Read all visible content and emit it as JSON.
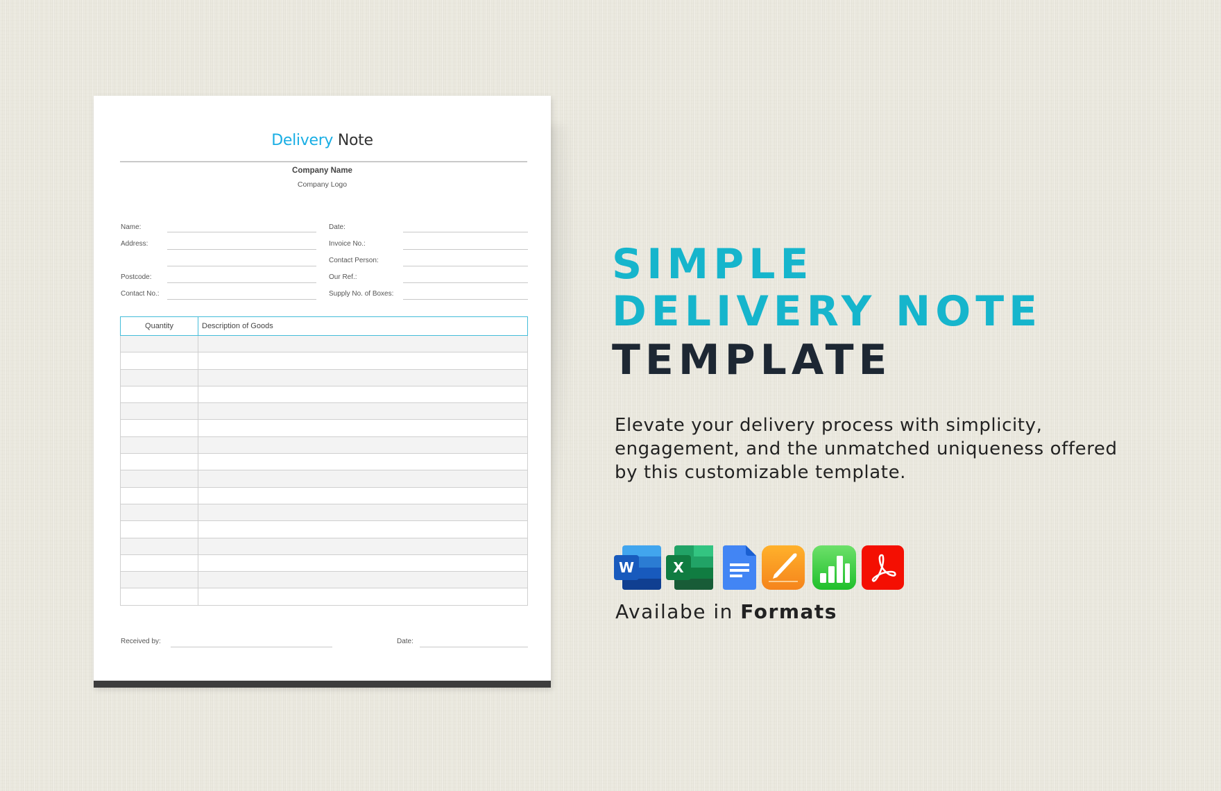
{
  "document": {
    "title_accent": "Delivery",
    "title_rest": "Note",
    "company_name": "Company Name",
    "company_logo": "Company Logo",
    "fields_left": [
      {
        "label": "Name:",
        "value": ""
      },
      {
        "label": "Address:",
        "value": ""
      },
      {
        "label": "",
        "value": ""
      },
      {
        "label": "Postcode:",
        "value": ""
      },
      {
        "label": "Contact No.:",
        "value": ""
      }
    ],
    "fields_right": [
      {
        "label": "Date:",
        "value": ""
      },
      {
        "label": "Invoice No.:",
        "value": ""
      },
      {
        "label": "Contact Person:",
        "value": ""
      },
      {
        "label": "Our Ref.:",
        "value": ""
      },
      {
        "label": "Supply No. of Boxes:",
        "value": ""
      }
    ],
    "table": {
      "columns": [
        "Quantity",
        "Description of Goods"
      ],
      "row_count": 16,
      "rows": []
    },
    "signature": {
      "received_by_label": "Received by:",
      "date_label": "Date:"
    }
  },
  "hero": {
    "line1": "SIMPLE",
    "line2": "DELIVERY NOTE",
    "line3": "TEMPLATE",
    "description_lines": [
      "Elevate your delivery process with simplicity,",
      "engagement, and the unmatched uniqueness offered",
      "by this customizable template."
    ]
  },
  "formats": {
    "icons": [
      "word-icon",
      "excel-icon",
      "google-docs-icon",
      "pages-icon",
      "numbers-icon",
      "pdf-icon"
    ],
    "caption_prefix": "Availabe in",
    "caption_bold": "Formats"
  },
  "colors": {
    "accent_cyan": "#16b5cc",
    "title_blue": "#19aee4",
    "dark_text": "#1d2733",
    "table_header_border": "#43bcd9",
    "background": "#ebe9df"
  }
}
